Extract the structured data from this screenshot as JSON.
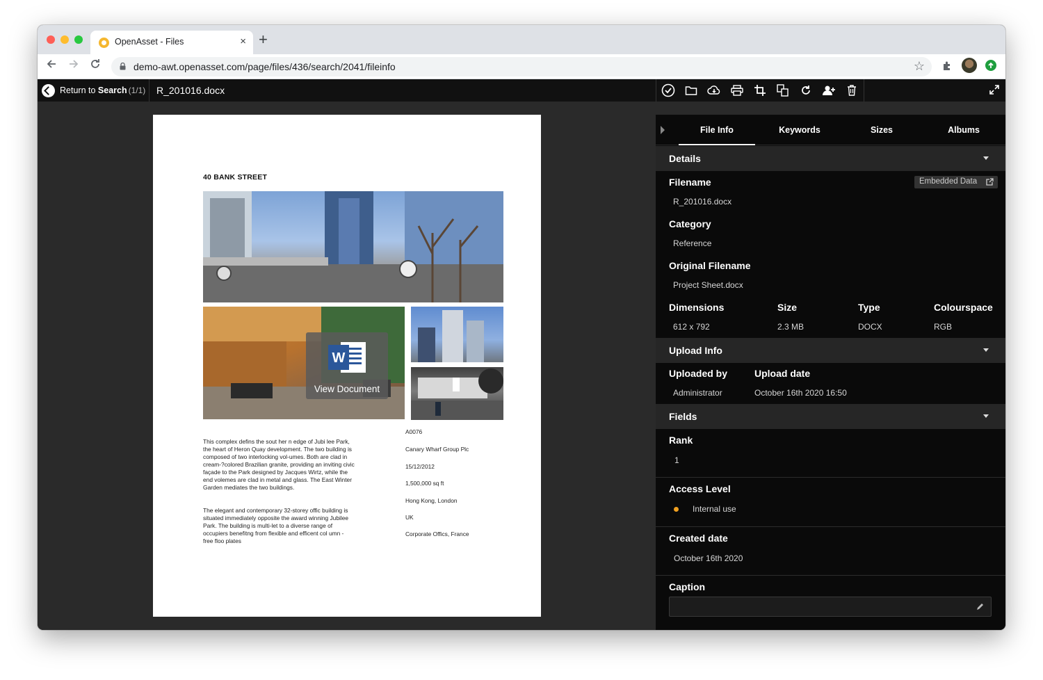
{
  "browser": {
    "tab_title": "OpenAsset - Files",
    "tab_close": "×",
    "new_tab": "+",
    "url": "demo-awt.openasset.com/page/files/436/search/2041/fileinfo"
  },
  "header": {
    "return_label": "Return to",
    "return_strong": "Search",
    "return_count": "(1/1)",
    "filename": "R_201016.docx",
    "tools": [
      "check-circle-icon",
      "folder-icon",
      "download-cloud-icon",
      "print-icon",
      "crop-icon",
      "convert-icon",
      "rotate-icon",
      "add-user-icon",
      "trash-icon"
    ]
  },
  "document": {
    "heading": "40 BANK STREET",
    "view_label": "View Document",
    "body_paragraph_1": "This complex defins the sout her n edge of Jubi lee Park, the heart of Heron Quay development. The two building is composed of two interlocking vol-umes. Both are clad in cream-?colored Brazilian granite, providing an inviting civic façade to the Park designed by Jacques Wirtz, while the end volemes are clad in metal and glass. The East Winter Garden mediates the two buildings.",
    "body_paragraph_2": "The elegant and contemporary 32-storey offic building is situated immediately opposite the award winning Jubilee Park. The building is multi-let to a diverse range of occupiers benefitng from flexible and efficent col umn - free floo plates",
    "meta": [
      "A0076",
      "Canary Wharf Group Plc",
      "15/12/2012",
      "1,500,000 sq ft",
      "Hong Kong, London",
      "UK",
      "Corporate Offics, France"
    ]
  },
  "panel": {
    "tabs": [
      "File Info",
      "Keywords",
      "Sizes",
      "Albums"
    ],
    "active_tab": "File Info",
    "details": {
      "title": "Details",
      "filename_label": "Filename",
      "filename_value": "R_201016.docx",
      "embedded_label": "Embedded Data",
      "category_label": "Category",
      "category_value": "Reference",
      "original_label": "Original Filename",
      "original_value": "Project Sheet.docx",
      "dimensions_label": "Dimensions",
      "dimensions_value": "612 x 792",
      "size_label": "Size",
      "size_value": "2.3 MB",
      "type_label": "Type",
      "type_value": "DOCX",
      "colourspace_label": "Colourspace",
      "colourspace_value": "RGB"
    },
    "upload": {
      "title": "Upload Info",
      "by_label": "Uploaded by",
      "by_value": "Administrator",
      "date_label": "Upload date",
      "date_value": "October 16th 2020 16:50"
    },
    "fields": {
      "title": "Fields",
      "rank_label": "Rank",
      "rank_value": "1",
      "access_label": "Access Level",
      "access_value": "Internal use",
      "created_label": "Created date",
      "created_value": "October 16th 2020",
      "caption_label": "Caption"
    }
  },
  "colors": {
    "access_dot": "#f0a020",
    "header_bg": "#111111",
    "panel_bg": "#0a0a0a",
    "section_bg": "#262626"
  }
}
